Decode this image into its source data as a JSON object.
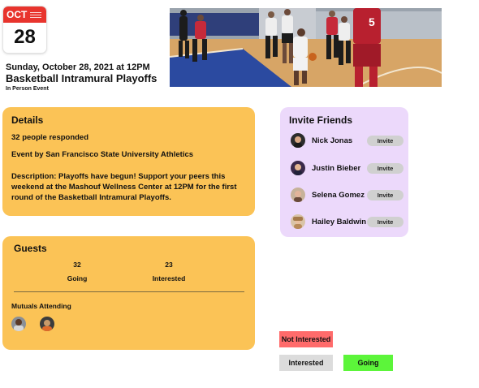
{
  "calendar": {
    "month": "OCT",
    "day": "28"
  },
  "event": {
    "date_line": "Sunday, October 28, 2021 at 12PM",
    "title": "Basketball Intramural Playoffs",
    "type": "In Person Event"
  },
  "details": {
    "heading": "Details",
    "responded": "32 people responded",
    "host": "Event by San Francisco State University Athletics",
    "description": "Description: Playoffs have begun! Support your peers this weekend at the Mashouf Wellness Center at 12PM for the first round of the Basketball Intramural Playoffs."
  },
  "guests": {
    "heading": "Guests",
    "going_count": "32",
    "going_label": "Going",
    "interested_count": "23",
    "interested_label": "Interested",
    "mutuals_label": "Mutuals Attending"
  },
  "invite_friends": {
    "heading": "Invite Friends",
    "button_label": "Invite",
    "friends": [
      {
        "name": "Nick Jonas"
      },
      {
        "name": "Justin Bieber"
      },
      {
        "name": "Selena Gomez"
      },
      {
        "name": "Hailey Baldwin"
      }
    ]
  },
  "rsvp": {
    "not_interested": "Not Interested",
    "interested": "Interested",
    "going": "Going"
  },
  "colors": {
    "card": "#fbc356",
    "invite_card": "#ecd9fb",
    "calendar_red": "#e8342d",
    "not_interested": "#ff6b6b",
    "interested": "#dcdcdc",
    "going": "#5cf53a"
  }
}
